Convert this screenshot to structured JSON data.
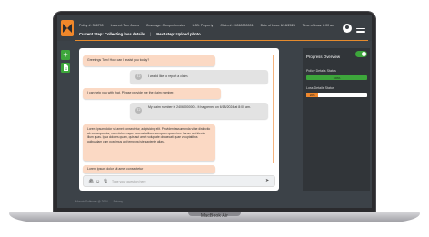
{
  "header": {
    "info": [
      "Policy #: 356790",
      "Insured: Tom Jones",
      "Coverage: Comprehensive",
      "LOB: Property",
      "Claim #: 24060000001",
      "Date of Loss: 6/18/2024",
      "Time of Loss: 8:00 am"
    ],
    "current_step": "Current Step: Collecting loss details",
    "separator": "|",
    "next_step": "Next step: Upload photo"
  },
  "chat": {
    "messages": [
      {
        "role": "bot",
        "text": "Greetings Tom! How can I assist you today?"
      },
      {
        "role": "user",
        "avatar": "TJ",
        "text": "I would like to report a claim."
      },
      {
        "role": "bot",
        "text": "I can help you with that. Please provide me the claim number."
      },
      {
        "role": "user",
        "avatar": "TJ",
        "text": "My claim number is 24060000001. It happened on 6/18/2024 at 8:00 am."
      },
      {
        "role": "bot",
        "text": "Lorem ipsum dolor sit amet consectetur, adipisicing elit. Provident assumenda vitae distinctio ab consequuntur, nam doloremque necessitatibus numquam quam iure harum architecto illum quas. Ipsa dolores quam, quis aut amet voluptate obcaecati quae voluptatibus quibusdam cum possimus aut tempora iste sapiente alias."
      },
      {
        "role": "bot",
        "text": "Lorem ipsum dolor sit amet consectetur"
      }
    ],
    "input_placeholder": "Type your question here"
  },
  "progress": {
    "title": "Progress Overview",
    "toggle_on": true,
    "items": [
      {
        "label": "Policy Details Status",
        "value_label": "100%",
        "fraction": 1.0,
        "color": "#3da63b"
      },
      {
        "label": "Loss Details Status",
        "value_label": "20%",
        "fraction": 0.2,
        "color": "#f0872a"
      }
    ]
  },
  "footer": {
    "copyright": "Mosaic Software @ 2024",
    "privacy": "Privacy"
  },
  "device_label": "MacBook Air",
  "colors": {
    "accent": "#f0872a",
    "success": "#3da63b",
    "background": "#3c4248"
  },
  "icons": [
    "logo-icon",
    "user-avatar-icon",
    "hamburger-menu-icon",
    "add-icon",
    "document-icon",
    "attach-icon",
    "emoji-icon",
    "microphone-icon",
    "send-icon"
  ]
}
